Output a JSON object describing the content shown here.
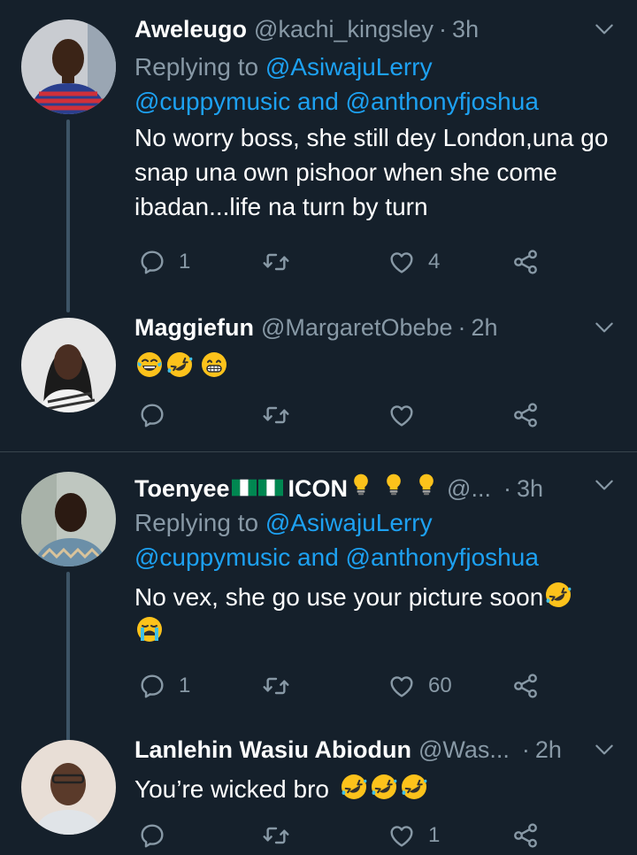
{
  "tweets": [
    {
      "name": "Aweleugo",
      "handle": "@kachi_kingsley",
      "time": "3h",
      "replying_to_prefix": "Replying to",
      "replying_mention_1": "@AsiwajuLerry",
      "replying_mention_2": "@cuppymusic",
      "replying_and": "and",
      "replying_mention_3": "@anthonyfjoshua",
      "text": "No worry boss, she still dey London,una go snap una own pishoor when she come ibadan...life na turn by turn",
      "reply_count": "1",
      "retweet_count": "",
      "like_count": "4"
    },
    {
      "name": "Maggiefun",
      "handle": "@MargaretObebe",
      "time": "2h",
      "emojis": [
        "face-with-tears-of-joy",
        "rolling-on-floor-laughing",
        "grinning-face"
      ],
      "reply_count": "",
      "retweet_count": "",
      "like_count": ""
    },
    {
      "name": "Toenyee",
      "name_suffix": "ICON",
      "handle": "@...",
      "time": "3h",
      "replying_to_prefix": "Replying to",
      "replying_mention_1": "@AsiwajuLerry",
      "replying_mention_2": "@cuppymusic",
      "replying_and": "and",
      "replying_mention_3": "@anthonyfjoshua",
      "text": "No vex, she go use your picture soon",
      "reply_count": "1",
      "retweet_count": "",
      "like_count": "60"
    },
    {
      "name": "Lanlehin Wasiu Abiodun",
      "handle": "@Was...",
      "time": "2h",
      "text": "You’re wicked bro",
      "reply_count": "",
      "retweet_count": "",
      "like_count": "1"
    }
  ],
  "dot_separator": "·",
  "colors": {
    "background": "#15202b",
    "secondary_text": "#8899a6",
    "mention": "#1da1f2",
    "divider": "#38444d"
  }
}
